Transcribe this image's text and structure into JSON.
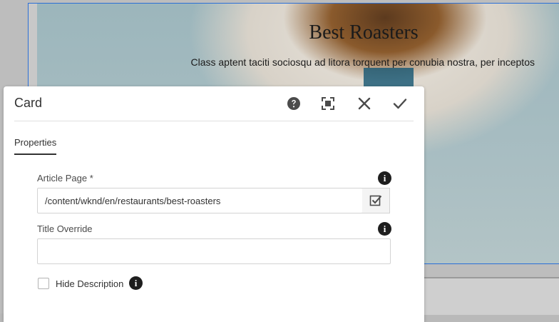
{
  "hero": {
    "title": "Best Roasters",
    "text": "Class aptent taciti sociosqu ad litora torquent per conubia nostra, per inceptos"
  },
  "dialog": {
    "title": "Card",
    "header_icons": [
      "help-icon",
      "fullscreen-icon",
      "close-icon",
      "checkmark-icon"
    ],
    "tabs": [
      {
        "label": "Properties",
        "active": true
      }
    ],
    "fields": {
      "article_page": {
        "label": "Article Page *",
        "value": "/content/wknd/en/restaurants/best-roasters"
      },
      "title_override": {
        "label": "Title Override",
        "value": ""
      },
      "hide_description": {
        "label": "Hide Description",
        "checked": false
      }
    }
  },
  "colors": {
    "selection_border": "#2b6fd6",
    "dialog_bg": "#ffffff",
    "text": "#323232"
  }
}
